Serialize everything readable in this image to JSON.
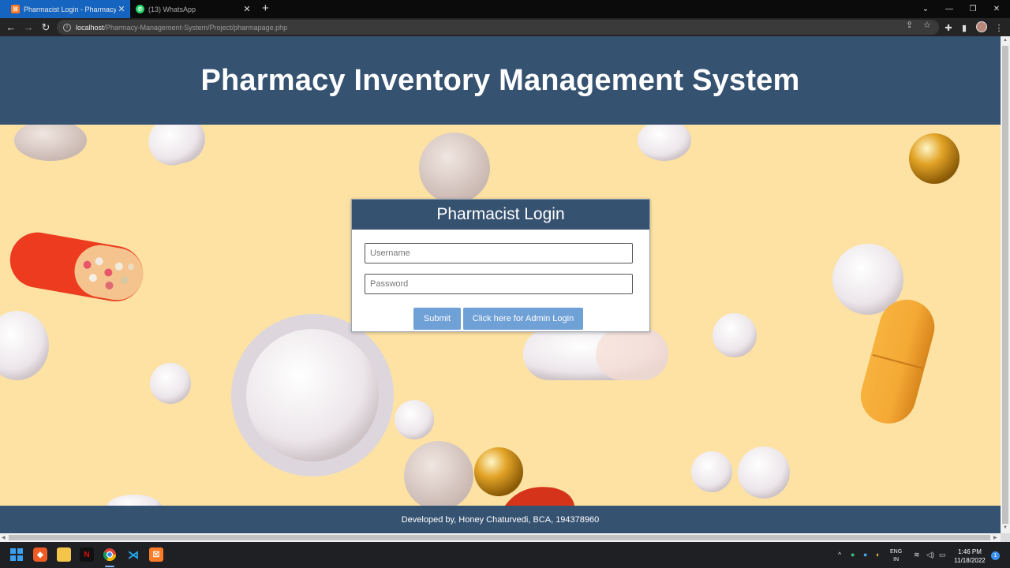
{
  "browser": {
    "tabs": [
      {
        "title": "Pharmacist Login - Pharmacy Inv",
        "active": true,
        "favicon": "xampp-icon"
      },
      {
        "title": "(13) WhatsApp",
        "active": false,
        "favicon": "whatsapp-icon"
      }
    ],
    "url_host": "localhost",
    "url_path": "/Pharmacy-Management-System/Project/pharmapage.php"
  },
  "page": {
    "title": "Pharmacy Inventory Management System",
    "login": {
      "heading": "Pharmacist Login",
      "username_placeholder": "Username",
      "password_placeholder": "Password",
      "submit_label": "Submit",
      "admin_label": "Click here for Admin Login"
    },
    "footer": "Developed by, Honey Chaturvedi, BCA, 194378960"
  },
  "taskbar": {
    "language_top": "ENG",
    "language_bottom": "IN",
    "time": "1:46 PM",
    "date": "11/18/2022",
    "notification_count": "1"
  },
  "colors": {
    "header": "#365271",
    "button": "#6fa0d6",
    "background": "#fde2a3"
  }
}
